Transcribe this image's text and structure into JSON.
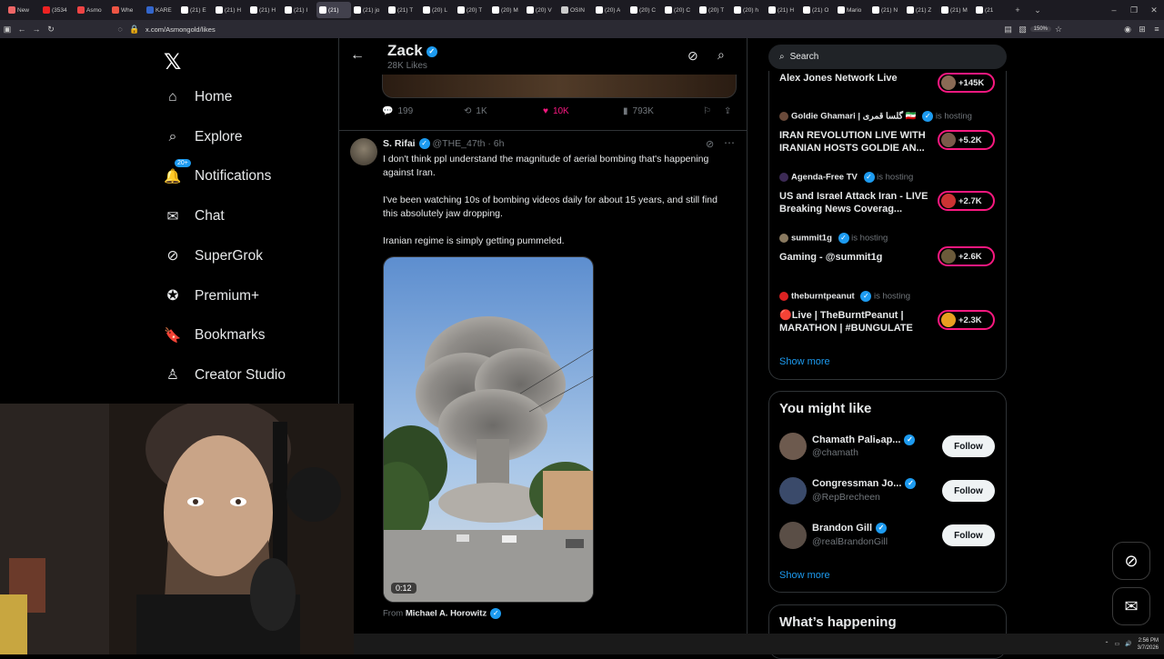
{
  "browser": {
    "tabs": [
      {
        "label": "New",
        "color": "#e66"
      },
      {
        "label": "(3534",
        "color": "#e22"
      },
      {
        "label": "Asmo",
        "color": "#e44"
      },
      {
        "label": "Whe",
        "color": "#e54"
      },
      {
        "label": "KARE",
        "color": "#36c"
      },
      {
        "label": "(21) E",
        "color": "#fff"
      },
      {
        "label": "(21) H",
        "color": "#fff"
      },
      {
        "label": "(21) H",
        "color": "#fff"
      },
      {
        "label": "(21) I",
        "color": "#fff"
      },
      {
        "label": "(21)",
        "color": "#fff"
      },
      {
        "label": "(21) jo",
        "color": "#fff"
      },
      {
        "label": "(21) T",
        "color": "#fff"
      },
      {
        "label": "(20) L",
        "color": "#fff"
      },
      {
        "label": "(20) T",
        "color": "#fff"
      },
      {
        "label": "(20) M",
        "color": "#fff"
      },
      {
        "label": "(20) V",
        "color": "#fff"
      },
      {
        "label": "OSIN",
        "color": "#ccc"
      },
      {
        "label": "(20) A",
        "color": "#fff"
      },
      {
        "label": "(20) C",
        "color": "#fff"
      },
      {
        "label": "(20) C",
        "color": "#fff"
      },
      {
        "label": "(20) T",
        "color": "#fff"
      },
      {
        "label": "(20) h",
        "color": "#fff"
      },
      {
        "label": "(21) H",
        "color": "#fff"
      },
      {
        "label": "(21) O",
        "color": "#fff"
      },
      {
        "label": "Mario",
        "color": "#fff"
      },
      {
        "label": "(21) N",
        "color": "#fff"
      },
      {
        "label": "(21) Z",
        "color": "#fff"
      },
      {
        "label": "(21) M",
        "color": "#fff"
      },
      {
        "label": "(21",
        "color": "#fff"
      }
    ],
    "url": "x.com/Asmongold/likes",
    "zoom": "150%"
  },
  "nav": {
    "items": [
      {
        "label": "Home",
        "icon": "home-icon"
      },
      {
        "label": "Explore",
        "icon": "search-icon"
      },
      {
        "label": "Notifications",
        "icon": "bell-icon",
        "badge": "20+"
      },
      {
        "label": "Chat",
        "icon": "mail-icon"
      },
      {
        "label": "SuperGrok",
        "icon": "grok-icon"
      },
      {
        "label": "Premium+",
        "icon": "verified-icon"
      },
      {
        "label": "Bookmarks",
        "icon": "bookmark-icon"
      },
      {
        "label": "Creator Studio",
        "icon": "creator-icon"
      }
    ]
  },
  "header": {
    "name": "Zack",
    "subtitle": "28K Likes"
  },
  "prev_tweet": {
    "replies": "199",
    "retweets": "1K",
    "likes": "10K",
    "views": "793K"
  },
  "tweet": {
    "author": "S. Rifai",
    "handle": "@THE_47th",
    "time": "6h",
    "para1": "I don't think ppl understand the magnitude of aerial bombing that's happening against Iran.",
    "para2": "I've been watching 10s of bombing videos daily for about 15 years, and still find this absolutely jaw dropping.",
    "para3": "Iranian regime is simply getting pummeled.",
    "video_duration": "0:12",
    "from_label": "From",
    "from_author": "Michael A. Horowitz"
  },
  "search": {
    "placeholder": "Search"
  },
  "live": {
    "top_title": "Alex Jones Network Live",
    "top_count": "+145K",
    "items": [
      {
        "host": "Goldie Ghamari | گلسا قمری 🇮🇷",
        "status": "is hosting",
        "title": "IRAN REVOLUTION LIVE WITH IRANIAN HOSTS GOLDIE AN...",
        "count": "+5.2K"
      },
      {
        "host": "Agenda-Free TV",
        "status": "is hosting",
        "title": "US and Israel Attack Iran - LIVE Breaking News Coverag...",
        "count": "+2.7K"
      },
      {
        "host": "summit1g",
        "status": "is hosting",
        "title": "Gaming - @summit1g",
        "count": "+2.6K"
      },
      {
        "host": "theburntpeanut",
        "status": "is hosting",
        "title": "🔴Live | TheBurntPeanut | MARATHON | #BUNGULATE",
        "count": "+2.3K"
      }
    ],
    "show_more": "Show more"
  },
  "you_might_like": {
    "title": "You might like",
    "users": [
      {
        "name": "Chamath Paliهap...",
        "handle": "@chamath",
        "follow": "Follow"
      },
      {
        "name": "Congressman Jo...",
        "handle": "@RepBrecheen",
        "follow": "Follow"
      },
      {
        "name": "Brandon Gill",
        "handle": "@realBrandonGill",
        "follow": "Follow"
      }
    ],
    "show_more": "Show more"
  },
  "whats_happening": {
    "title": "What’s happening"
  },
  "taskbar": {
    "time": "2:56 PM",
    "date": "3/7/2026"
  },
  "colors": {
    "accent": "#1d9bf0",
    "like": "#f91880",
    "background": "#000000"
  }
}
